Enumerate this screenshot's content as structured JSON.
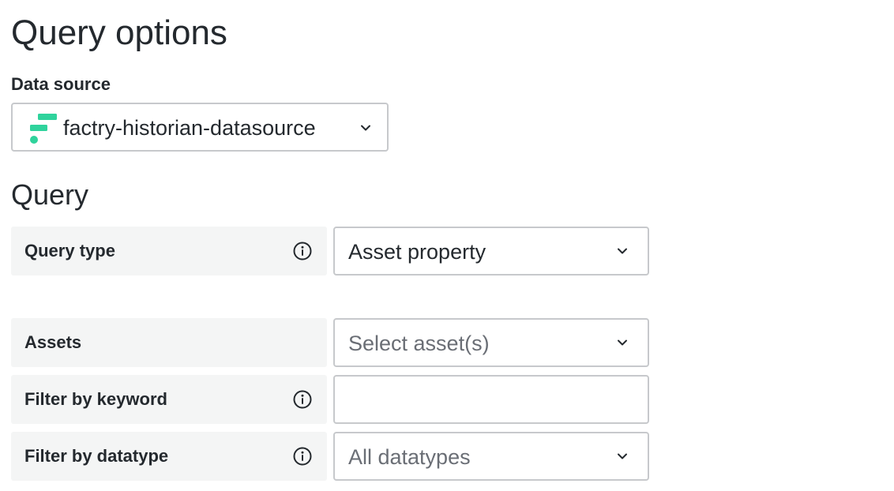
{
  "page": {
    "title": "Query options"
  },
  "data_source": {
    "label": "Data source",
    "selected": "factry-historian-datasource",
    "logo_icon": "factry-logo-icon",
    "logo_color": "#2fd39c"
  },
  "query": {
    "heading": "Query",
    "query_type": {
      "label": "Query type",
      "value": "Asset property"
    },
    "assets": {
      "label": "Assets",
      "placeholder": "Select asset(s)"
    },
    "filter_keyword": {
      "label": "Filter by keyword",
      "value": ""
    },
    "filter_datatype": {
      "label": "Filter by datatype",
      "placeholder": "All datatypes"
    }
  }
}
